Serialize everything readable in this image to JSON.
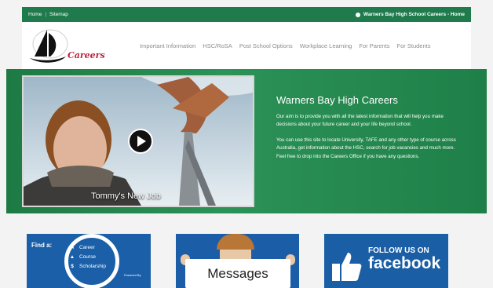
{
  "topbar": {
    "links": [
      "Home",
      "Sitemap"
    ],
    "breadcrumb": "Warners Bay High School Careers - Home"
  },
  "header": {
    "logo_text": "Careers",
    "nav": [
      "Important Information",
      "HSC/RoSA",
      "Post School Options",
      "Workplace Learning",
      "For Parents",
      "For Students"
    ]
  },
  "hero": {
    "video_caption": "Tommy's New Job",
    "title": "Warners Bay High Careers",
    "paragraph1": "Our aim is to provide you with all the latest information that will help you make decisions about your future career and your life beyond school.",
    "paragraph2": "You can use this site to locate University, TAFE and any other type of course across Australia, get information about the HSC, search for job vacancies and much more. Feel free to drop into the Careers Office if you have any questions."
  },
  "tiles": {
    "find": {
      "title": "Find a:",
      "items": [
        "Career",
        "Course",
        "Scholarship"
      ],
      "powered": "Powered By"
    },
    "messages": {
      "label": "Messages"
    },
    "facebook": {
      "follow": "FOLLOW US ON",
      "name": "facebook"
    }
  },
  "colors": {
    "brand_green": "#1f7a4c",
    "tile_blue": "#1a5fa8",
    "logo_red": "#c0213c"
  }
}
